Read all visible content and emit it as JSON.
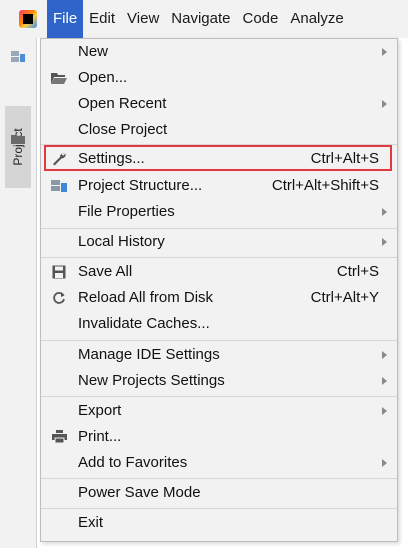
{
  "menubar": {
    "items": [
      {
        "label": "File",
        "active": true
      },
      {
        "label": "Edit",
        "active": false
      },
      {
        "label": "View",
        "active": false
      },
      {
        "label": "Navigate",
        "active": false
      },
      {
        "label": "Code",
        "active": false
      },
      {
        "label": "Analyze",
        "active": false
      }
    ]
  },
  "toolstrip": {
    "project_tab_label": "Project"
  },
  "file_menu": {
    "items": [
      {
        "label": "New",
        "shortcut": "",
        "submenu": true,
        "icon": ""
      },
      {
        "label": "Open...",
        "shortcut": "",
        "submenu": false,
        "icon": "folder-open-icon"
      },
      {
        "label": "Open Recent",
        "shortcut": "",
        "submenu": true,
        "icon": ""
      },
      {
        "label": "Close Project",
        "shortcut": "",
        "submenu": false,
        "icon": ""
      },
      {
        "label": "Settings...",
        "shortcut": "Ctrl+Alt+S",
        "submenu": false,
        "icon": "wrench-icon",
        "highlighted": true
      },
      {
        "label": "Project Structure...",
        "shortcut": "Ctrl+Alt+Shift+S",
        "submenu": false,
        "icon": "project-structure-icon"
      },
      {
        "label": "File Properties",
        "shortcut": "",
        "submenu": true,
        "icon": ""
      },
      {
        "label": "Local History",
        "shortcut": "",
        "submenu": true,
        "icon": ""
      },
      {
        "label": "Save All",
        "shortcut": "Ctrl+S",
        "submenu": false,
        "icon": "save-icon"
      },
      {
        "label": "Reload All from Disk",
        "shortcut": "Ctrl+Alt+Y",
        "submenu": false,
        "icon": "reload-icon"
      },
      {
        "label": "Invalidate Caches...",
        "shortcut": "",
        "submenu": false,
        "icon": ""
      },
      {
        "label": "Manage IDE Settings",
        "shortcut": "",
        "submenu": true,
        "icon": ""
      },
      {
        "label": "New Projects Settings",
        "shortcut": "",
        "submenu": true,
        "icon": ""
      },
      {
        "label": "Export",
        "shortcut": "",
        "submenu": true,
        "icon": ""
      },
      {
        "label": "Print...",
        "shortcut": "",
        "submenu": false,
        "icon": "printer-icon"
      },
      {
        "label": "Add to Favorites",
        "shortcut": "",
        "submenu": true,
        "icon": ""
      },
      {
        "label": "Power Save Mode",
        "shortcut": "",
        "submenu": false,
        "icon": ""
      },
      {
        "label": "Exit",
        "shortcut": "",
        "submenu": false,
        "icon": ""
      }
    ]
  },
  "colors": {
    "menubar_active": "#2f65ca",
    "highlight_border": "#e03a3e",
    "menu_background": "#f2f2f2"
  }
}
